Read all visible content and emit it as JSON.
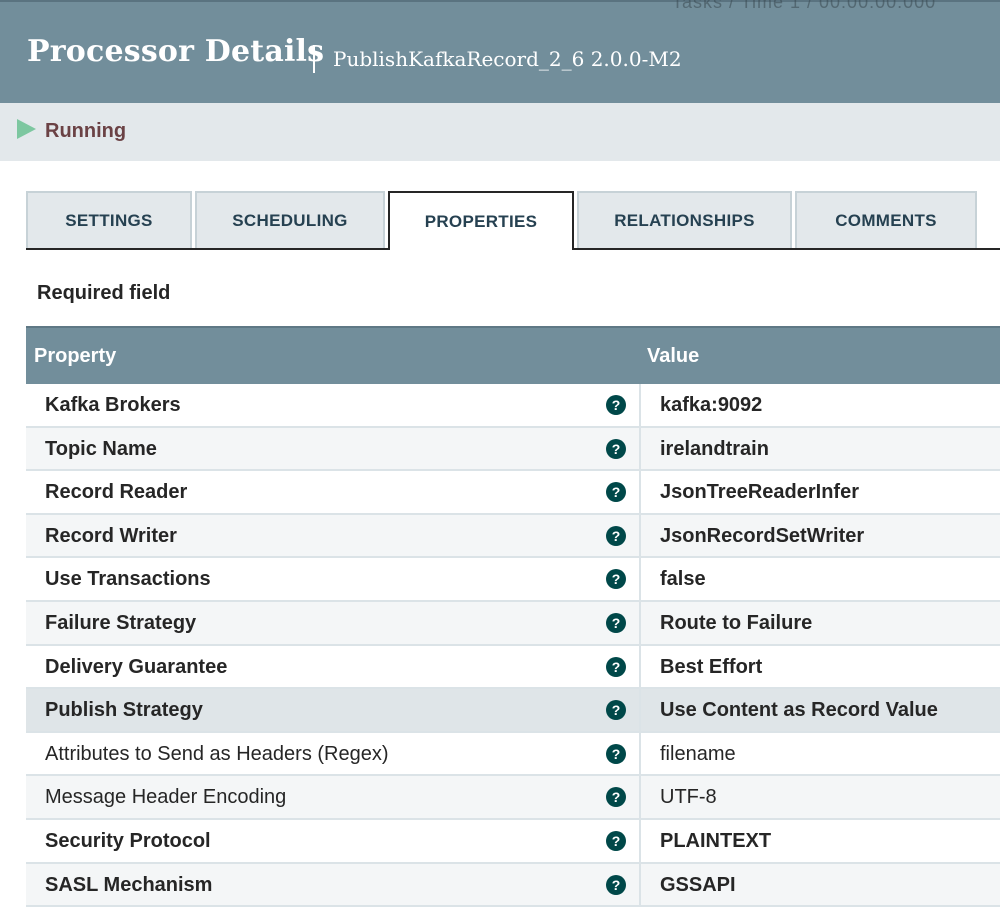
{
  "header": {
    "title": "Processor Details",
    "subtitle": "PublishKafkaRecord_2_6 2.0.0-M2",
    "clipped_text": "Tasks / Time  1 / 00:00:00.000"
  },
  "status": {
    "label": "Running"
  },
  "tabs": [
    {
      "label": "SETTINGS"
    },
    {
      "label": "SCHEDULING"
    },
    {
      "label": "PROPERTIES"
    },
    {
      "label": "RELATIONSHIPS"
    },
    {
      "label": "COMMENTS"
    }
  ],
  "active_tab": "PROPERTIES",
  "required_label": "Required field",
  "table": {
    "columns": {
      "property": "Property",
      "value": "Value"
    },
    "rows": [
      {
        "name": "Kafka Brokers",
        "value": "kafka:9092",
        "required": true
      },
      {
        "name": "Topic Name",
        "value": "irelandtrain",
        "required": true
      },
      {
        "name": "Record Reader",
        "value": "JsonTreeReaderInfer",
        "required": true
      },
      {
        "name": "Record Writer",
        "value": "JsonRecordSetWriter",
        "required": true
      },
      {
        "name": "Use Transactions",
        "value": "false",
        "required": true
      },
      {
        "name": "Failure Strategy",
        "value": "Route to Failure",
        "required": true
      },
      {
        "name": "Delivery Guarantee",
        "value": "Best Effort",
        "required": true
      },
      {
        "name": "Publish Strategy",
        "value": "Use Content as Record Value",
        "required": true
      },
      {
        "name": "Attributes to Send as Headers (Regex)",
        "value": "filename",
        "required": false
      },
      {
        "name": "Message Header Encoding",
        "value": "UTF-8",
        "required": false
      },
      {
        "name": "Security Protocol",
        "value": "PLAINTEXT",
        "required": true
      },
      {
        "name": "SASL Mechanism",
        "value": "GSSAPI",
        "required": true
      }
    ]
  },
  "icons": {
    "help": "question-mark-icon",
    "status": "play-icon"
  },
  "colors": {
    "header_bg": "#728e9b",
    "status_text": "#6b4245",
    "running_icon": "#7dc7a0",
    "help_icon": "#004849"
  }
}
